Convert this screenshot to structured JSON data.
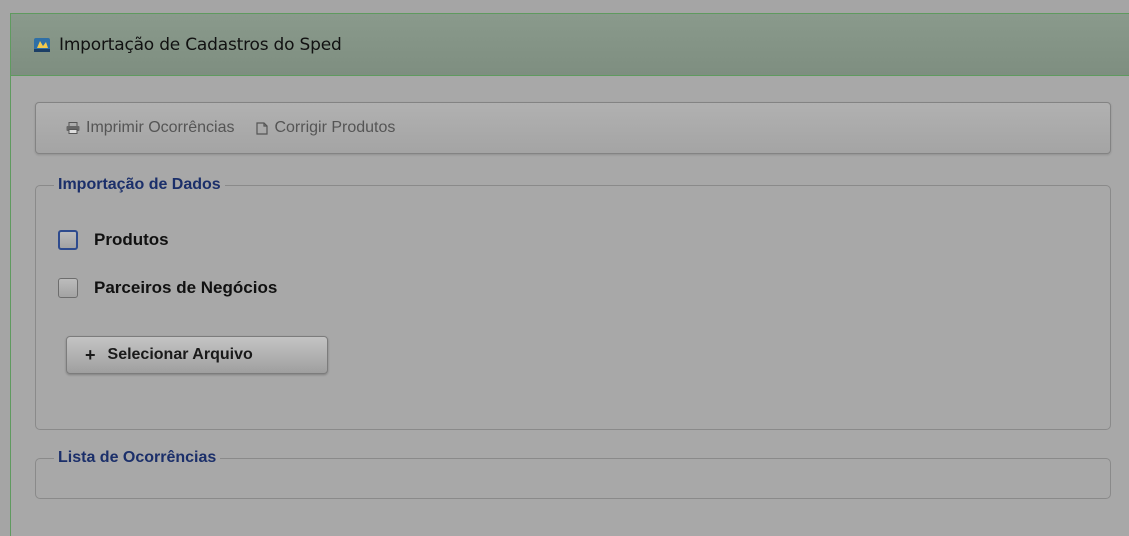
{
  "window": {
    "title": "Importação de Cadastros do Sped",
    "icon": "sped-app-icon"
  },
  "toolbar": {
    "print_label": "Imprimir Ocorrências",
    "print_icon": "printer-icon",
    "fix_label": "Corrigir Produtos",
    "fix_icon": "document-icon"
  },
  "import_section": {
    "legend": "Importação de Dados",
    "options": [
      {
        "label": "Produtos",
        "checked": false,
        "focused": true
      },
      {
        "label": "Parceiros de Negócios",
        "checked": false,
        "focused": false
      }
    ],
    "select_file_label": "Selecionar Arquivo"
  },
  "occurrences_section": {
    "legend": "Lista de Ocorrências"
  },
  "colors": {
    "legend_text": "#1b2f6a",
    "header_border": "#5f9a5f"
  }
}
